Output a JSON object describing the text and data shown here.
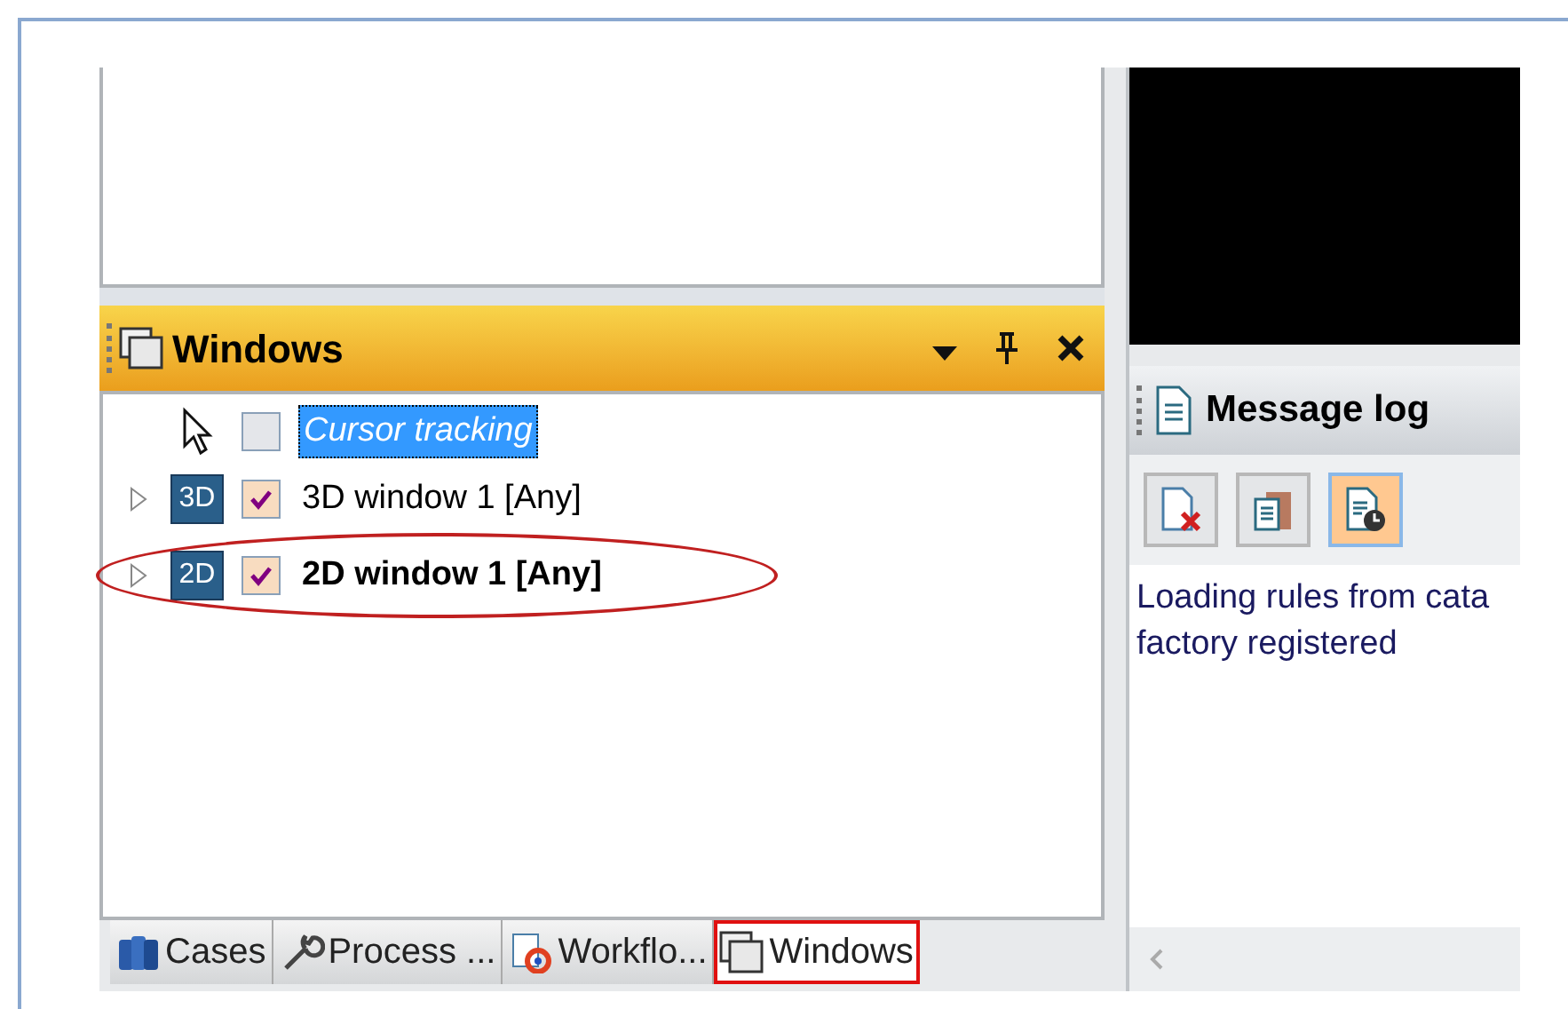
{
  "windows_panel": {
    "title": "Windows",
    "items": [
      {
        "kind": "cursor",
        "label": "Cursor tracking",
        "checked": false,
        "selected": true,
        "bold": false,
        "expandable": false,
        "circled": false
      },
      {
        "kind": "window",
        "badge": "3D",
        "label": "3D window 1 [Any]",
        "checked": true,
        "selected": false,
        "bold": false,
        "expandable": true,
        "circled": false
      },
      {
        "kind": "window",
        "badge": "2D",
        "label": "2D window 1 [Any]",
        "checked": true,
        "selected": false,
        "bold": true,
        "expandable": true,
        "circled": true
      }
    ]
  },
  "tabs": [
    {
      "kind": "cases",
      "label": "Cases",
      "selected": false,
      "outlined": false
    },
    {
      "kind": "process",
      "label": "Process ...",
      "selected": false,
      "outlined": false
    },
    {
      "kind": "workflow",
      "label": "Workflo...",
      "selected": false,
      "outlined": false
    },
    {
      "kind": "windows",
      "label": "Windows",
      "selected": true,
      "outlined": true
    }
  ],
  "message_log": {
    "title": "Message log",
    "toolbar": [
      {
        "kind": "clear",
        "pressed": false
      },
      {
        "kind": "copy",
        "pressed": false
      },
      {
        "kind": "timestamp",
        "pressed": true
      }
    ],
    "lines": [
      "Loading rules from cata",
      "factory registered"
    ]
  }
}
